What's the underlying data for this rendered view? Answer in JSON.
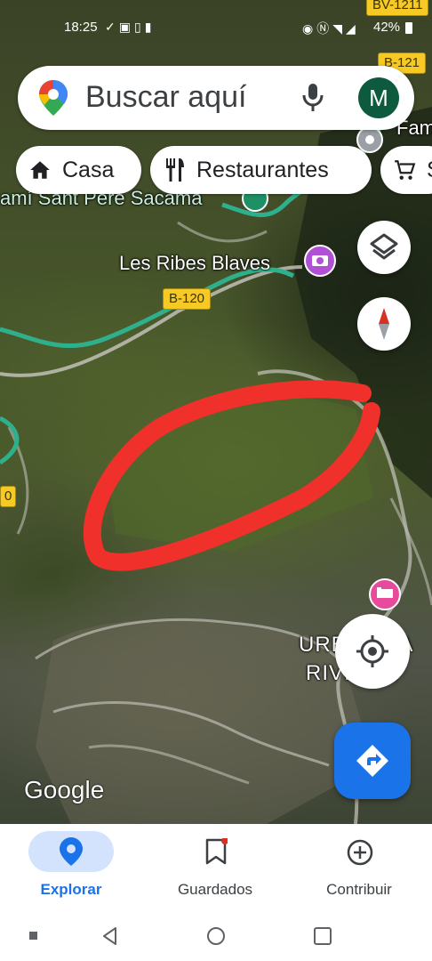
{
  "status_bar": {
    "time": "18:25",
    "battery": "42%",
    "left_icons": [
      "check-icon",
      "image-icon",
      "sim-icon",
      "battery-saver-icon"
    ],
    "right_icons": [
      "location-icon",
      "nfc-icon",
      "wifi-icon",
      "signal-icon",
      "battery-icon"
    ]
  },
  "search": {
    "placeholder": "Buscar aquí",
    "avatar_initial": "M",
    "avatar_color": "#0d5a3e"
  },
  "chips": [
    {
      "label": "Casa",
      "icon": "home-icon"
    },
    {
      "label": "Restaurantes",
      "icon": "restaurant-icon"
    },
    {
      "label": "S",
      "icon": "shopping-cart-icon"
    }
  ],
  "map": {
    "labels": {
      "cami": "amí Sant Pere Sacama",
      "les_ribes": "Les Ribes Blaves",
      "fam": "Fam",
      "urb_line1": "URBANIZA",
      "urb_line2": "RIVIERA"
    },
    "road_shields": {
      "b120": "B-120",
      "b121": "B-121",
      "bv1211": "BV-1211",
      "left_edge": "0"
    },
    "logo": "Google",
    "annotation_color": "#f0302a"
  },
  "bottom_nav": {
    "items": [
      {
        "label": "Explorar",
        "icon": "location-pin-icon",
        "active": true
      },
      {
        "label": "Guardados",
        "icon": "bookmark-icon",
        "active": false
      },
      {
        "label": "Contribuir",
        "icon": "add-circle-icon",
        "active": false
      }
    ],
    "active_color": "#1a73e8"
  }
}
